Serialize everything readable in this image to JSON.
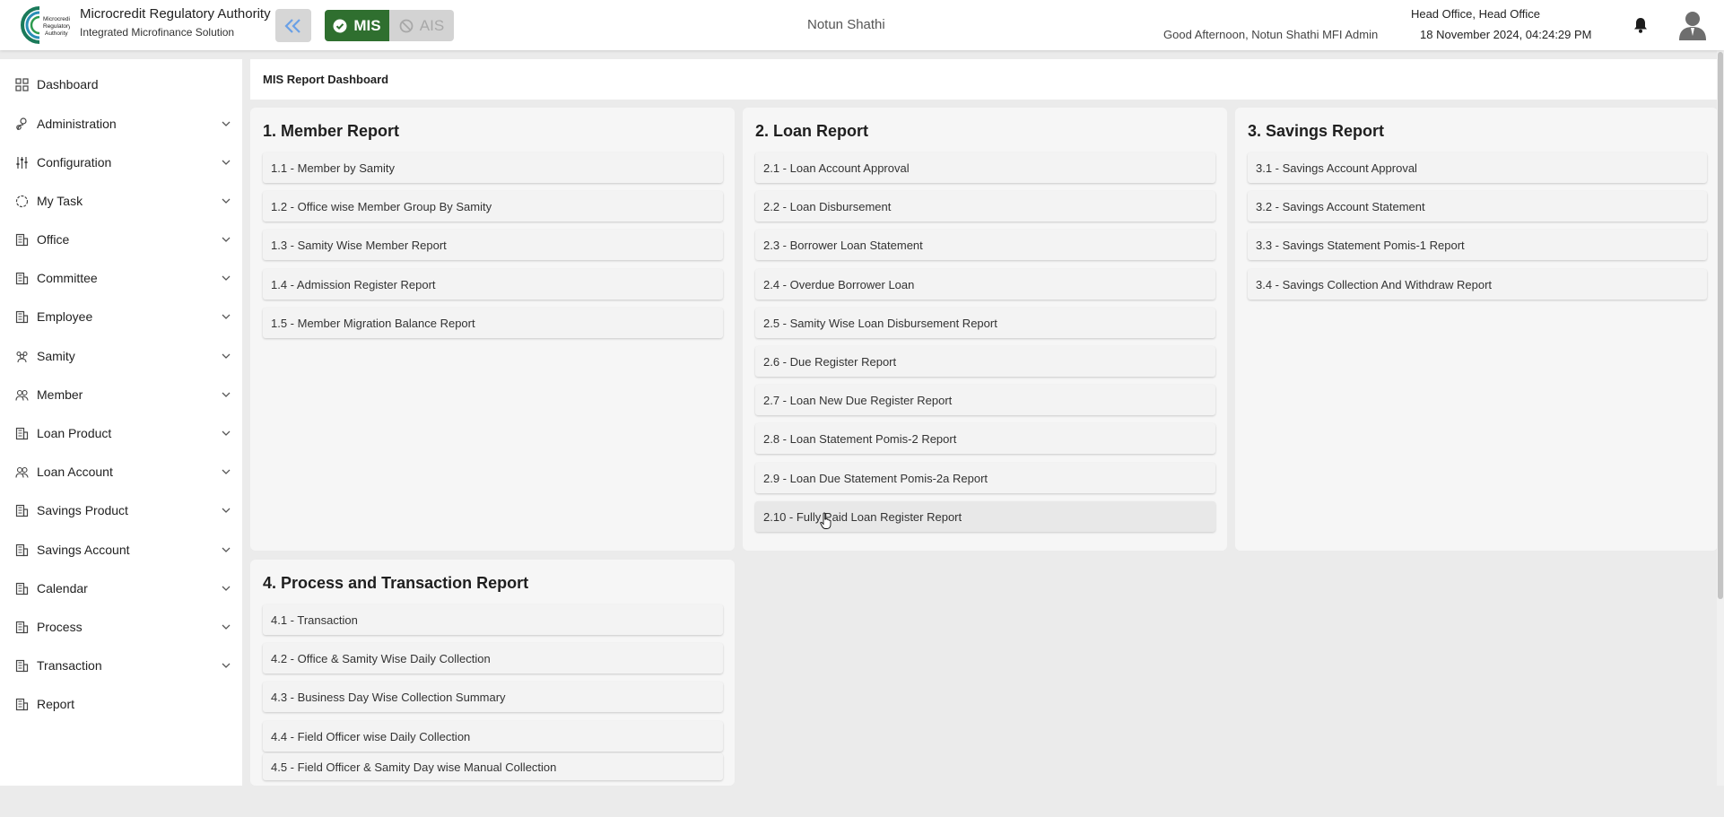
{
  "header": {
    "brand_title": "Microcredit Regulatory Authority",
    "brand_subtitle": "Integrated Microfinance Solution",
    "logo_text": "Microcredit Regulatory Authority",
    "toggle_mis": "MIS",
    "toggle_ais": "AIS",
    "org_name": "Notun Shathi",
    "greeting": "Good Afternoon, Notun Shathi MFI Admin",
    "office": "Head Office, Head Office",
    "datetime": "18 November 2024, 04:24:29 PM",
    "colors": {
      "mis_active": "#2f6f2f",
      "ais_inactive": "#d3d3d3"
    }
  },
  "sidebar": {
    "items": [
      {
        "label": "Dashboard",
        "icon": "grid-icon",
        "expandable": false
      },
      {
        "label": "Administration",
        "icon": "admin-icon",
        "expandable": true
      },
      {
        "label": "Configuration",
        "icon": "sliders-icon",
        "expandable": true
      },
      {
        "label": "My Task",
        "icon": "task-icon",
        "expandable": true
      },
      {
        "label": "Office",
        "icon": "building-icon",
        "expandable": true
      },
      {
        "label": "Committee",
        "icon": "building-icon",
        "expandable": true
      },
      {
        "label": "Employee",
        "icon": "building-icon",
        "expandable": true
      },
      {
        "label": "Samity",
        "icon": "group-icon",
        "expandable": true
      },
      {
        "label": "Member",
        "icon": "users-icon",
        "expandable": true
      },
      {
        "label": "Loan Product",
        "icon": "building-icon",
        "expandable": true
      },
      {
        "label": "Loan Account",
        "icon": "users-icon",
        "expandable": true
      },
      {
        "label": "Savings Product",
        "icon": "building-icon",
        "expandable": true
      },
      {
        "label": "Savings Account",
        "icon": "building-icon",
        "expandable": true
      },
      {
        "label": "Calendar",
        "icon": "building-icon",
        "expandable": true
      },
      {
        "label": "Process",
        "icon": "building-icon",
        "expandable": true
      },
      {
        "label": "Transaction",
        "icon": "building-icon",
        "expandable": true
      },
      {
        "label": "Report",
        "icon": "building-icon",
        "expandable": false
      }
    ]
  },
  "main": {
    "title": "MIS Report Dashboard",
    "cards": [
      {
        "title": "1. Member Report",
        "items": [
          "1.1 - Member by Samity",
          "1.2 - Office wise Member Group By Samity",
          "1.3 - Samity Wise Member Report",
          "1.4 - Admission Register Report",
          "1.5 - Member Migration Balance Report"
        ]
      },
      {
        "title": "2. Loan Report",
        "items": [
          "2.1 - Loan Account Approval",
          "2.2 - Loan Disbursement",
          "2.3 - Borrower Loan Statement",
          "2.4 - Overdue Borrower Loan",
          "2.5 - Samity Wise Loan Disbursement Report",
          "2.6 - Due Register Report",
          "2.7 - Loan New Due Register Report",
          "2.8 - Loan Statement Pomis-2 Report",
          "2.9 - Loan Due Statement Pomis-2a Report",
          "2.10 - Fully Paid Loan Register Report"
        ]
      },
      {
        "title": "3. Savings Report",
        "items": [
          "3.1 - Savings Account Approval",
          "3.2 - Savings Account Statement",
          "3.3 - Savings Statement Pomis-1 Report",
          "3.4 - Savings Collection And Withdraw Report"
        ]
      },
      {
        "title": "4. Process and Transaction Report",
        "items": [
          "4.1 - Transaction",
          "4.2 - Office & Samity Wise Daily Collection",
          "4.3 - Business Day Wise Collection Summary",
          "4.4 - Field Officer wise Daily Collection",
          "4.5 - Field Officer & Samity Day wise Manual Collection"
        ]
      }
    ]
  }
}
